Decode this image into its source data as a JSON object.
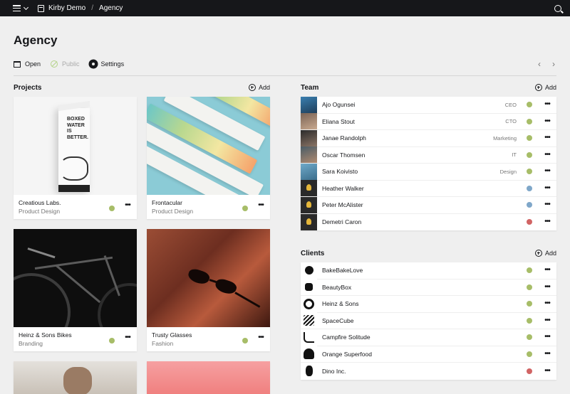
{
  "topbar": {
    "site_name": "Kirby Demo",
    "page_crumb": "Agency"
  },
  "page": {
    "title": "Agency"
  },
  "toolbar": {
    "open_label": "Open",
    "public_label": "Public",
    "settings_label": "Settings",
    "prev_symbol": "‹",
    "next_symbol": "›"
  },
  "projects": {
    "label": "Projects",
    "add_label": "Add",
    "cards": [
      {
        "title": "Creatious Labs.",
        "subtitle": "Product Design",
        "status": "listed",
        "status_color": "#a7bd68"
      },
      {
        "title": "Frontacular",
        "subtitle": "Product Design",
        "status": "listed",
        "status_color": "#a7bd68"
      },
      {
        "title": "Heinz & Sons Bikes",
        "subtitle": "Branding",
        "status": "listed",
        "status_color": "#a7bd68"
      },
      {
        "title": "Trusty Glasses",
        "subtitle": "Fashion",
        "status": "listed",
        "status_color": "#a7bd68"
      }
    ]
  },
  "team": {
    "label": "Team",
    "add_label": "Add",
    "members": [
      {
        "name": "Ajo Ogunsei",
        "role": "CEO",
        "status_color": "#a7bd68"
      },
      {
        "name": "Eliana Stout",
        "role": "CTO",
        "status_color": "#a7bd68"
      },
      {
        "name": "Janae Randolph",
        "role": "Marketing",
        "status_color": "#a7bd68"
      },
      {
        "name": "Oscar Thomsen",
        "role": "IT",
        "status_color": "#a7bd68"
      },
      {
        "name": "Sara Koivisto",
        "role": "Design",
        "status_color": "#a7bd68"
      },
      {
        "name": "Heather Walker",
        "role": "",
        "status_color": "#7fa7c9"
      },
      {
        "name": "Peter McAlister",
        "role": "",
        "status_color": "#7fa7c9"
      },
      {
        "name": "Demetri Caron",
        "role": "",
        "status_color": "#d16464"
      }
    ]
  },
  "clients": {
    "label": "Clients",
    "add_label": "Add",
    "items": [
      {
        "name": "BakeBakeLove",
        "status_color": "#a7bd68"
      },
      {
        "name": "BeautyBox",
        "status_color": "#a7bd68"
      },
      {
        "name": "Heinz & Sons",
        "status_color": "#a7bd68"
      },
      {
        "name": "SpaceCube",
        "status_color": "#a7bd68"
      },
      {
        "name": "Campfire Solitude",
        "status_color": "#a7bd68"
      },
      {
        "name": "Orange Superfood",
        "status_color": "#a7bd68"
      },
      {
        "name": "Dino Inc.",
        "status_color": "#d16464"
      }
    ]
  },
  "options_label": "•••",
  "carton_text": "BOXED WATER IS BETTER."
}
